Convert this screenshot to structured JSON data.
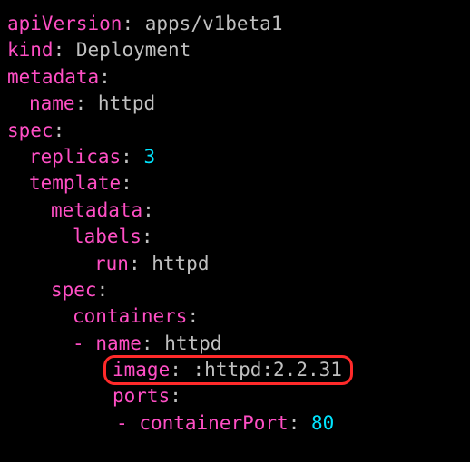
{
  "yaml": {
    "apiVersion": {
      "key": "apiVersion",
      "value": "apps/v1beta1"
    },
    "kind": {
      "key": "kind",
      "value": "Deployment"
    },
    "metadata": {
      "key": "metadata"
    },
    "metadata_name": {
      "key": "name",
      "value": "httpd"
    },
    "spec": {
      "key": "spec"
    },
    "replicas": {
      "key": "replicas",
      "value": "3"
    },
    "template": {
      "key": "template"
    },
    "template_metadata": {
      "key": "metadata"
    },
    "labels": {
      "key": "labels"
    },
    "run": {
      "key": "run",
      "value": "httpd"
    },
    "template_spec": {
      "key": "spec"
    },
    "containers": {
      "key": "containers"
    },
    "container_name": {
      "key": "name",
      "value": "httpd"
    },
    "image": {
      "key": "image",
      "value": ":httpd:2.2.31"
    },
    "ports": {
      "key": "ports"
    },
    "containerPort": {
      "key": "containerPort",
      "value": "80"
    }
  },
  "punct": {
    "colon": ":",
    "dash": "-"
  }
}
